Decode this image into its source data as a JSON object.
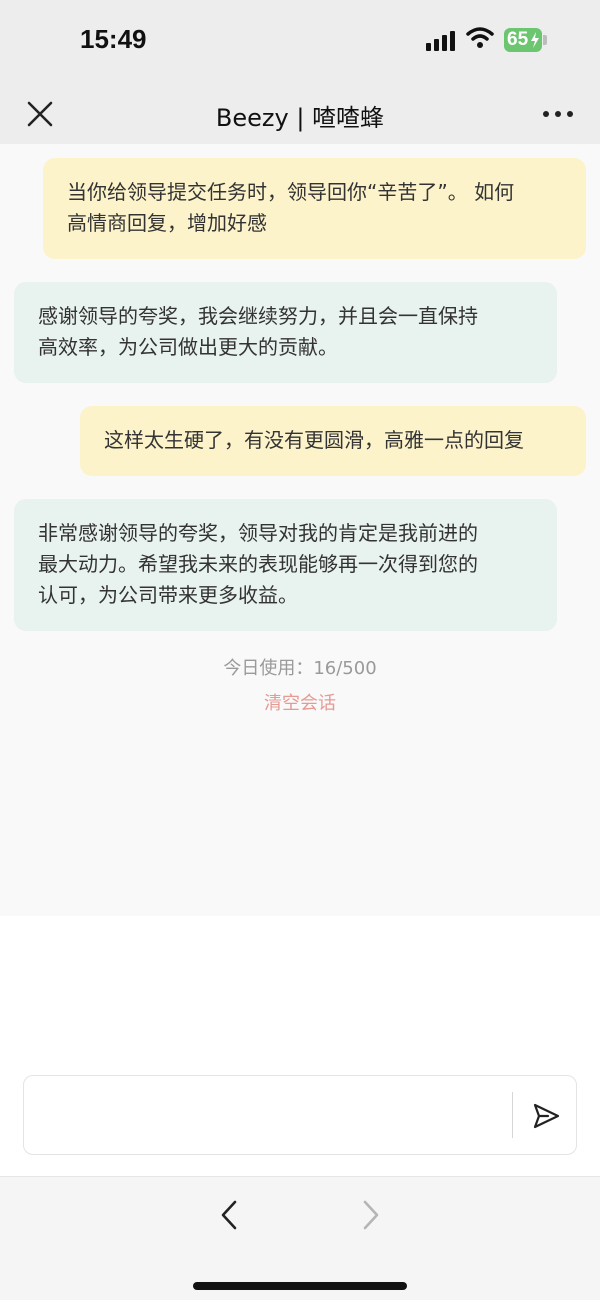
{
  "status_bar": {
    "time": "15:49",
    "battery": "65",
    "icons": [
      "signal-icon",
      "wifi-icon",
      "battery-icon",
      "charging-bolt-icon"
    ]
  },
  "nav": {
    "title": "Beezy | 喳喳蜂",
    "icons": [
      "close-icon",
      "more-icon"
    ]
  },
  "messages": [
    {
      "role": "user",
      "lines": [
        "当你给领导提交任务时，领导回你“辛苦了”。 如何",
        "高情商回复，增加好感"
      ]
    },
    {
      "role": "bot",
      "lines": [
        "感谢领导的夸奖，我会继续努力，并且会一直保持",
        "高效率，为公司做出更大的贡献。"
      ]
    },
    {
      "role": "user",
      "lines": [
        "这样太生硬了，有没有更圆滑，高雅一点的回复"
      ]
    },
    {
      "role": "bot",
      "lines": [
        "非常感谢领导的夸奖，领导对我的肯定是我前进的",
        "最大动力。希望我未来的表现能够再一次得到您的",
        "认可，为公司带来更多收益。"
      ]
    }
  ],
  "usage_text": "今日使用：16/500",
  "clear_label": "清空会话",
  "input": {
    "value": "",
    "placeholder": "",
    "icons": [
      "send-icon"
    ]
  },
  "bottom_nav": {
    "icons": [
      "back-arrow-icon",
      "forward-arrow-icon"
    ]
  },
  "colors": {
    "user_bubble": "#fcf3cb",
    "bot_bubble": "#e8f2ef",
    "clear_link": "#e59a93",
    "battery": "#6cc56f"
  }
}
